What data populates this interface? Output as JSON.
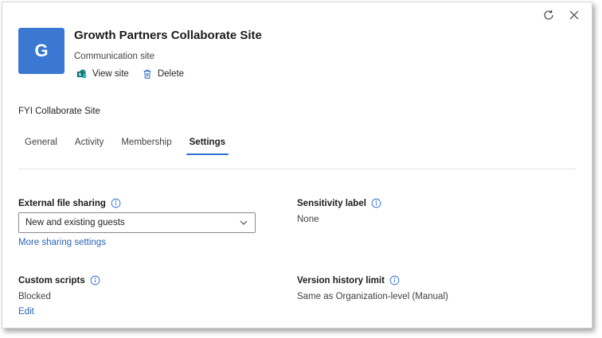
{
  "icons": {
    "refresh": "refresh-icon",
    "close": "close-icon",
    "view_site": "sharepoint-icon",
    "delete": "trash-icon",
    "info": "info-icon",
    "chevron": "chevron-down-icon"
  },
  "colors": {
    "accent": "#2f6fcf",
    "avatar_bg": "#3a78d4",
    "link": "#2a64b8"
  },
  "header": {
    "avatar_letter": "G",
    "title": "Growth Partners Collaborate Site",
    "site_type": "Communication site",
    "actions": {
      "view_site": "View site",
      "delete": "Delete"
    }
  },
  "description": "FYI Collaborate Site",
  "tabs": [
    {
      "label": "General",
      "active": false
    },
    {
      "label": "Activity",
      "active": false
    },
    {
      "label": "Membership",
      "active": false
    },
    {
      "label": "Settings",
      "active": true
    }
  ],
  "settings": {
    "external_sharing": {
      "label": "External file sharing",
      "selected": "New and existing guests",
      "more_link": "More sharing settings"
    },
    "sensitivity": {
      "label": "Sensitivity label",
      "value": "None"
    },
    "custom_scripts": {
      "label": "Custom scripts",
      "value": "Blocked",
      "edit_link": "Edit"
    },
    "version_history": {
      "label": "Version history limit",
      "value": "Same as Organization-level (Manual)"
    }
  }
}
